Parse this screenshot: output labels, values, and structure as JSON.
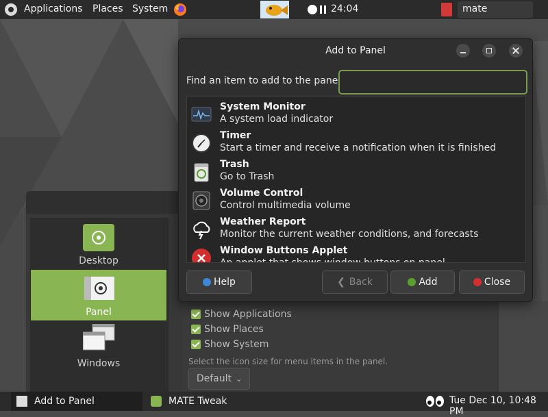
{
  "top_panel": {
    "menus": [
      "Applications",
      "Places",
      "System"
    ],
    "timer": "24:04",
    "user": "mate"
  },
  "dialog": {
    "title": "Add to Panel",
    "find_label": "Find an item to add to the panel:",
    "find_value": "",
    "items": [
      {
        "title": "System Monitor",
        "desc": "A system load indicator",
        "icon": "system-monitor-icon"
      },
      {
        "title": "Timer",
        "desc": "Start a timer and receive a notification when it is finished",
        "icon": "timer-icon"
      },
      {
        "title": "Trash",
        "desc": "Go to Trash",
        "icon": "trash-icon"
      },
      {
        "title": "Volume Control",
        "desc": "Control multimedia volume",
        "icon": "speaker-icon"
      },
      {
        "title": "Weather Report",
        "desc": "Monitor the current weather conditions, and forecasts",
        "icon": "weather-icon"
      },
      {
        "title": "Window Buttons Applet",
        "desc": "An applet that shows window buttons on panel",
        "icon": "window-buttons-icon"
      }
    ],
    "buttons": {
      "help": "Help",
      "back": "Back",
      "add": "Add",
      "close": "Close"
    }
  },
  "tweak": {
    "sidebar": [
      {
        "label": "Desktop",
        "active": false
      },
      {
        "label": "Panel",
        "active": true
      },
      {
        "label": "Windows",
        "active": false
      }
    ],
    "checks": [
      "Show Applications",
      "Show Places",
      "Show System"
    ],
    "note": "Select the icon size for menu items in the panel.",
    "dropdown": "Default"
  },
  "bottom_panel": {
    "tasks": [
      "Add to Panel",
      "MATE Tweak"
    ],
    "clock": "Tue Dec 10, 10:48 PM"
  },
  "colors": {
    "accent": "#8ab553",
    "panel": "#2b2b2b",
    "close": "#d32f2f",
    "help": "#3f86d6"
  }
}
